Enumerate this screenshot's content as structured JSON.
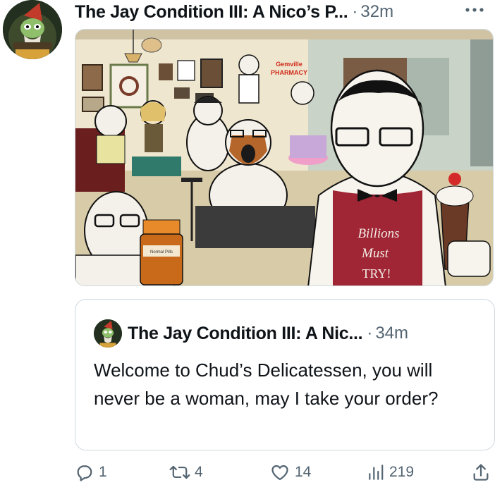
{
  "post": {
    "author_name": "The Jay Condition III: A Nico’s P...",
    "separator": "·",
    "time": "32m",
    "more_label": "More options"
  },
  "media": {
    "sign_line1": "Gemville",
    "sign_line2": "PHARMACY",
    "apron_line1": "Billions",
    "apron_line2": "Must",
    "apron_line3": "TRY!",
    "bottle_label": "Normal Pills"
  },
  "quote": {
    "author_name": "The Jay Condition III: A Nic...",
    "separator": "·",
    "time": "34m",
    "text": "Welcome to Chud’s Delicatessen, you will never be a woman, may I take your order?"
  },
  "actions": {
    "replies": "1",
    "reposts": "4",
    "likes": "14",
    "views": "219"
  },
  "colors": {
    "text": "#0f1419",
    "secondary": "#536471",
    "border": "#cfd9de",
    "apron_red": "#a02535"
  }
}
